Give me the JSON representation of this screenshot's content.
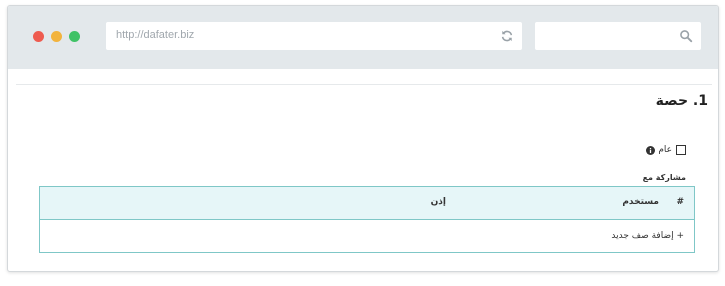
{
  "browser": {
    "url": "http://dafater.biz",
    "search_placeholder": ""
  },
  "page": {
    "title": "1. حصة"
  },
  "form": {
    "public_label": "عام",
    "public_checked": false,
    "share_with_label": "مشاركة مع"
  },
  "table": {
    "columns": [
      "#",
      "مستخدم",
      "إذن"
    ],
    "add_row_label": "+ إضافة صف جديد"
  },
  "colors": {
    "chrome": "#e3e8eb",
    "table_border": "#7fc7c7",
    "table_header": "#e6f6f8",
    "close_dot": "#ee5b4f",
    "minimize_dot": "#f2b33d",
    "maximize_dot": "#3fc266"
  },
  "icons": [
    "close-dot",
    "minimize-dot",
    "maximize-dot",
    "refresh-icon",
    "search-icon",
    "checkbox",
    "info-icon"
  ]
}
